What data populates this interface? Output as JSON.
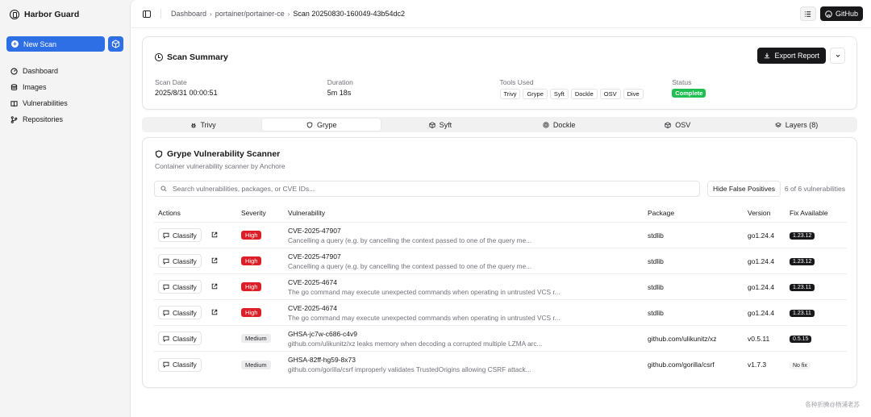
{
  "brand": {
    "name": "Harbor Guard"
  },
  "sidebar": {
    "new_scan_label": "New Scan",
    "items": [
      {
        "label": "Dashboard",
        "icon": "dashboard-icon"
      },
      {
        "label": "Images",
        "icon": "database-icon"
      },
      {
        "label": "Vulnerabilities",
        "icon": "book-icon"
      },
      {
        "label": "Repositories",
        "icon": "git-icon"
      }
    ]
  },
  "topbar": {
    "breadcrumb": [
      "Dashboard",
      "portainer/portainer-ce",
      "Scan 20250830-160049-43b54dc2"
    ],
    "github_label": "GitHub"
  },
  "summary": {
    "title": "Scan Summary",
    "export_label": "Export Report",
    "scan_date_label": "Scan Date",
    "scan_date": "2025/8/31 00:00:51",
    "duration_label": "Duration",
    "duration": "5m 18s",
    "tools_label": "Tools Used",
    "tools": [
      "Trivy",
      "Grype",
      "Syft",
      "Dockle",
      "OSV",
      "Dive"
    ],
    "status_label": "Status",
    "status": "Complete"
  },
  "tabs": [
    {
      "label": "Trivy",
      "icon": "bug-icon"
    },
    {
      "label": "Grype",
      "icon": "shield-icon"
    },
    {
      "label": "Syft",
      "icon": "package-icon"
    },
    {
      "label": "Dockle",
      "icon": "target-icon"
    },
    {
      "label": "OSV",
      "icon": "package-icon"
    },
    {
      "label": "Layers (8)",
      "icon": "layers-icon"
    }
  ],
  "scanner": {
    "title": "Grype Vulnerability Scanner",
    "subtitle": "Container vulnerability scanner by Anchore",
    "search_placeholder": "Search vulnerabilities, packages, or CVE IDs...",
    "hide_fp_label": "Hide False Positives",
    "count_text": "6 of 6 vulnerabilities",
    "columns": [
      "Actions",
      "Severity",
      "Vulnerability",
      "Package",
      "Version",
      "Fix Available"
    ],
    "classify_label": "Classify",
    "rows": [
      {
        "severity": "High",
        "id": "CVE-2025-47907",
        "desc": "Cancelling a query (e.g. by cancelling the context passed to one of the query me...",
        "package": "stdlib",
        "version": "go1.24.4",
        "fix": "1.23.12",
        "link": true
      },
      {
        "severity": "High",
        "id": "CVE-2025-47907",
        "desc": "Cancelling a query (e.g. by cancelling the context passed to one of the query me...",
        "package": "stdlib",
        "version": "go1.24.4",
        "fix": "1.23.12",
        "link": true
      },
      {
        "severity": "High",
        "id": "CVE-2025-4674",
        "desc": "The go command may execute unexpected commands when operating in untrusted VCS r...",
        "package": "stdlib",
        "version": "go1.24.4",
        "fix": "1.23.11",
        "link": true
      },
      {
        "severity": "High",
        "id": "CVE-2025-4674",
        "desc": "The go command may execute unexpected commands when operating in untrusted VCS r...",
        "package": "stdlib",
        "version": "go1.24.4",
        "fix": "1.23.11",
        "link": true
      },
      {
        "severity": "Medium",
        "id": "GHSA-jc7w-c686-c4v9",
        "desc": "github.com/ulikunitz/xz leaks memory when decoding a corrupted multiple LZMA arc...",
        "package": "github.com/ulikunitz/xz",
        "version": "v0.5.11",
        "fix": "0.5.15",
        "link": false
      },
      {
        "severity": "Medium",
        "id": "GHSA-82ff-hg59-8x73",
        "desc": "github.com/gorilla/csrf improperly validates TrustedOrigins allowing CSRF attack...",
        "package": "github.com/gorilla/csrf",
        "version": "v1.7.3",
        "fix": "No fix",
        "link": false
      }
    ]
  },
  "watermark": "各种折腾@杨浦老苏",
  "colors": {
    "primary": "#2f6fe6",
    "high": "#dc1f26",
    "complete": "#1fbf51",
    "dark": "#18181b"
  }
}
